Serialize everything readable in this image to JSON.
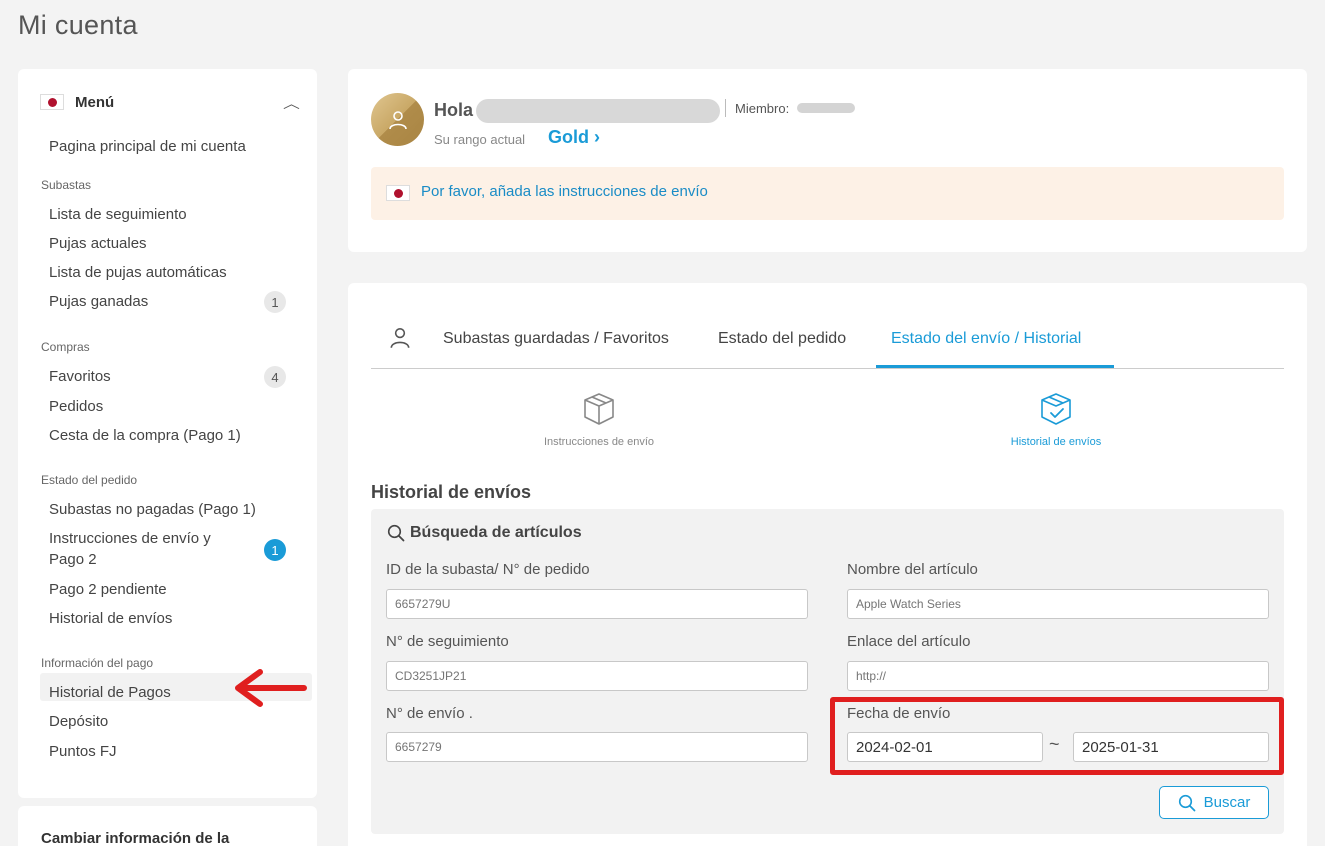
{
  "page": {
    "title": "Mi cuenta"
  },
  "sidebar": {
    "menu_label": "Menú",
    "items": {
      "home": "Pagina principal de mi cuenta",
      "sec_subastas": "Subastas",
      "seguimiento": "Lista de seguimiento",
      "pujas_actuales": "Pujas actuales",
      "pujas_auto": "Lista de pujas automáticas",
      "pujas_ganadas": "Pujas ganadas",
      "pujas_ganadas_count": "1",
      "sec_compras": "Compras",
      "favoritos": "Favoritos",
      "favoritos_count": "4",
      "pedidos": "Pedidos",
      "cesta": "Cesta de la compra (Pago 1)",
      "sec_estado": "Estado del pedido",
      "no_pagadas": "Subastas no pagadas (Pago 1)",
      "instrucciones_1": "Instrucciones de envío y",
      "instrucciones_2": "Pago 2",
      "instrucciones_count": "1",
      "pago2": "Pago 2 pendiente",
      "historial_envios": "Historial de envíos",
      "sec_pago": "Información del pago",
      "historial_pagos": "Historial de Pagos",
      "deposito": "Depósito",
      "puntos": "Puntos FJ"
    },
    "second_card_title": "Cambiar información de la"
  },
  "profile": {
    "greeting": "Hola",
    "member_label": "Miembro:",
    "rank_label": "Su rango actual",
    "rank_value": "Gold ›",
    "notice": "Por favor, añada las instrucciones de envío"
  },
  "tabs": {
    "favoritos": "Subastas guardadas / Favoritos",
    "pedido": "Estado del pedido",
    "envio": "Estado del envío / Historial"
  },
  "subtabs": {
    "instrucciones": "Instrucciones de envío",
    "historial": "Historial de envíos"
  },
  "section": {
    "title": "Historial de envíos"
  },
  "search": {
    "title": "Búsqueda de artículos",
    "auction_id_label": "ID de la subasta/ N° de pedido",
    "auction_id_placeholder": "6657279U",
    "item_name_label": "Nombre del artículo",
    "item_name_placeholder": "Apple Watch Series",
    "tracking_label": "N° de seguimiento",
    "tracking_placeholder": "CD3251JP21",
    "item_link_label": "Enlace del artículo",
    "item_link_placeholder": "http://",
    "shipment_no_label": "N° de envío .",
    "shipment_no_placeholder": "6657279",
    "date_label": "Fecha de envío",
    "date_from": "2024-02-01",
    "date_to": "2025-01-31",
    "separator": "~",
    "button": "Buscar"
  },
  "colors": {
    "accent": "#1a9bd7",
    "highlight": "#e01f1f",
    "notice_bg": "#fdf1e6",
    "flag_red": "#b0112e"
  }
}
